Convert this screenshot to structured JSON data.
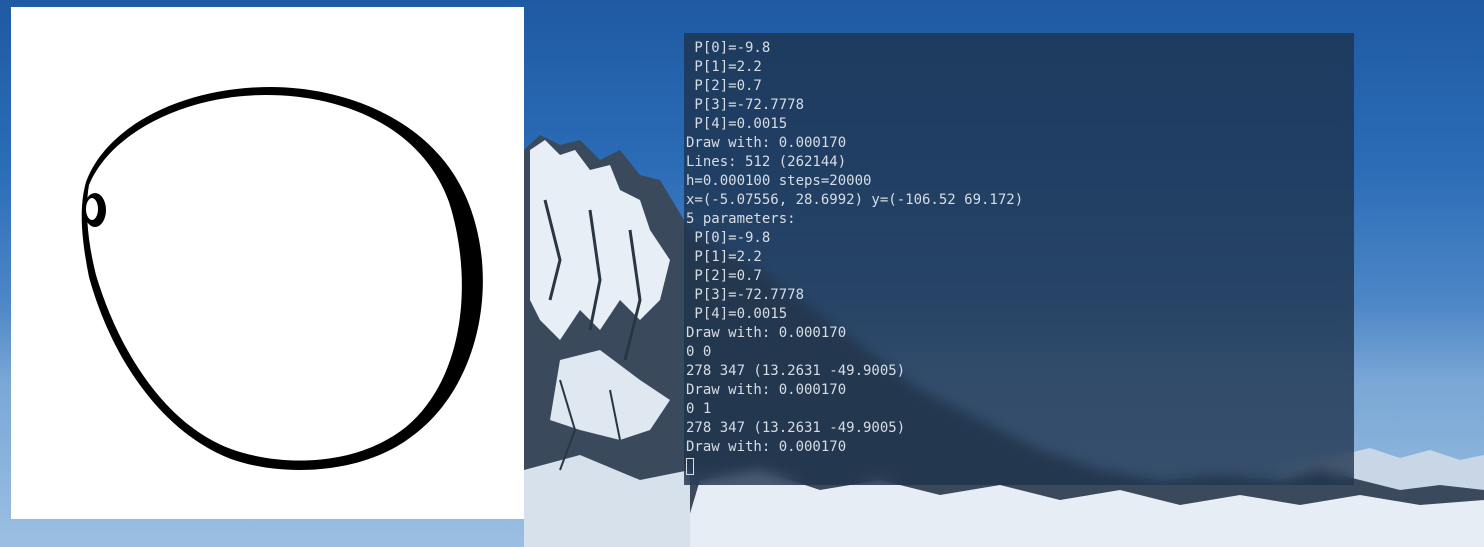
{
  "terminal": {
    "lines": [
      " P[0]=-9.8",
      " P[1]=2.2",
      " P[2]=0.7",
      " P[3]=-72.7778",
      " P[4]=0.0015",
      "Draw with: 0.000170",
      "Lines: 512 (262144)",
      "h=0.000100 steps=20000",
      "x=(-5.07556, 28.6992) y=(-106.52 69.172)",
      "5 parameters:",
      " P[0]=-9.8",
      " P[1]=2.2",
      " P[2]=0.7",
      " P[3]=-72.7778",
      " P[4]=0.0015",
      "Draw with: 0.000170",
      "0 0",
      "278 347 (13.2631 -49.9005)",
      "Draw with: 0.000170",
      "0 1",
      "278 347 (13.2631 -49.9005)",
      "Draw with: 0.000170"
    ]
  },
  "colors": {
    "terminal_text": "#d8dde4",
    "terminal_bg": "#1e324b",
    "plot_bg": "#ffffff",
    "curve": "#000000"
  }
}
